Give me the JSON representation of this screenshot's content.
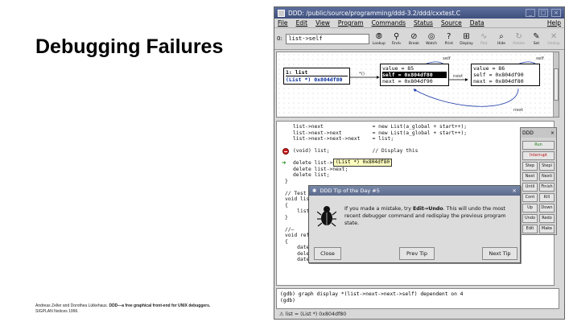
{
  "slide": {
    "title": "Debugging Failures",
    "citation_authors": "Andreas Zeller and Dorothea Lütkehaus.",
    "citation_title": "DDD—a free graphical front-end for UNIX debuggers.",
    "citation_venue": "SIGPLAN Notices 1996."
  },
  "window": {
    "title": "DDD: /public/source/programming/ddd-3.2/ddd/cxxtest.C",
    "min": "_",
    "max": "□",
    "close": "×"
  },
  "menubar": {
    "items": [
      "File",
      "Edit",
      "View",
      "Program",
      "Commands",
      "Status",
      "Source",
      "Data"
    ],
    "help": "Help"
  },
  "toolbar": {
    "arg_label": "0:",
    "arg_value": "list->self",
    "tools": [
      {
        "label": "Lookup",
        "icon": "lookup-icon",
        "glyph": "⦾"
      },
      {
        "label": "Find»",
        "icon": "find-icon",
        "glyph": "⚲"
      },
      {
        "label": "Break",
        "icon": "break-icon",
        "glyph": "⊘"
      },
      {
        "label": "Watch",
        "icon": "watch-icon",
        "glyph": "◎"
      },
      {
        "label": "Print",
        "icon": "print-icon",
        "glyph": "?"
      },
      {
        "label": "Display",
        "icon": "display-icon",
        "glyph": "⊞"
      },
      {
        "label": "Plot",
        "icon": "plot-icon",
        "glyph": "∿",
        "disabled": true
      },
      {
        "label": "Hide",
        "icon": "hide-icon",
        "glyph": "⌕"
      },
      {
        "label": "Rotate",
        "icon": "rotate-icon",
        "glyph": "↻",
        "disabled": true
      },
      {
        "label": "Set",
        "icon": "set-icon",
        "glyph": "✎"
      },
      {
        "label": "Undisp",
        "icon": "undisplay-icon",
        "glyph": "✕",
        "disabled": true
      }
    ]
  },
  "data_display": {
    "node1": {
      "title": "1: list",
      "value": "(List *) 0x804df80"
    },
    "node2": {
      "value": "value = 85",
      "self": "self  = 0x804df80",
      "next": "next  = 0x804df90"
    },
    "node3": {
      "value": "value = 86",
      "self": "self  = 0x804df90",
      "next": "next  = 0x804df80"
    },
    "edge_star": "*()",
    "edge_self_1": "self",
    "edge_self_2": "self",
    "edge_next_1": "next",
    "edge_next_2": "next"
  },
  "source": {
    "lines": [
      "list->next                = new List(a_global + start++);",
      "list->next->next          = new List(a_global + start++);",
      "list->next->next->next    = list;",
      "",
      "(void) list;              // Display this",
      "",
      "delete list->next->next;",
      "delete list->next;",
      "delete list;",
      "}",
      "",
      "// Test",
      "void lis",
      "{",
      "    list",
      "}",
      "",
      "//—",
      "void ref",
      "{",
      "    date",
      "    dele",
      "    date"
    ],
    "tooltip": "(List *) 0x804df80"
  },
  "command_tool": {
    "title": "DDD",
    "buttons": [
      "Run",
      "Interrupt",
      "Step",
      "Stepi",
      "Next",
      "Nexti",
      "Until",
      "Finish",
      "Cont",
      "Kill",
      "Up",
      "Down",
      "Undo",
      "Redo",
      "Edit",
      "Make"
    ]
  },
  "tip_dialog": {
    "title": "DDD Tip of the Day #5",
    "text_before": "If you made a mistake, try ",
    "text_bold": "Edit→Undo",
    "text_after": ".  This will undo the most recent debugger command and redisplay the previous program state.",
    "close": "Close",
    "prev": "Prev Tip",
    "next": "Next Tip"
  },
  "console": {
    "line1": "(gdb) graph display *(list->next->next->self) dependent on 4",
    "line2": "(gdb) "
  },
  "status": {
    "text": "⚠ list = (List *) 0x804df80"
  },
  "colors": {
    "titlebar": "#4a5b8a",
    "selected": "#000000",
    "pointer_blue": "#002a9c",
    "run": "#1d7c1d",
    "interrupt": "#bb1111"
  }
}
